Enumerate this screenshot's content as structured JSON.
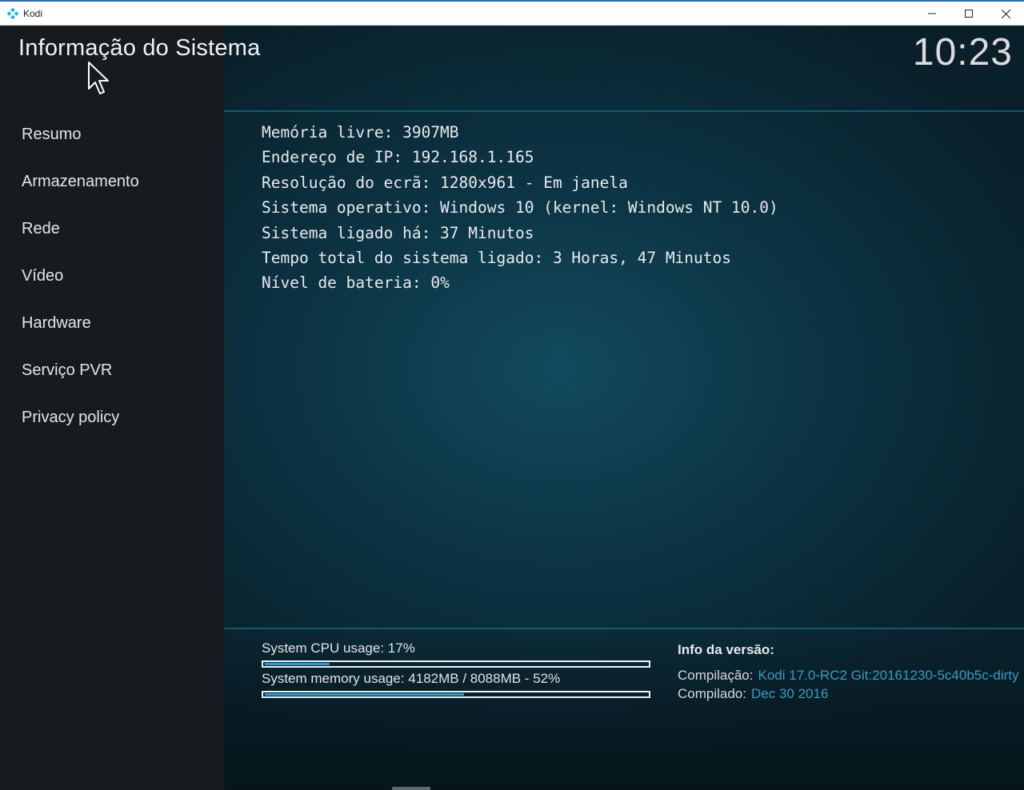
{
  "window": {
    "title": "Kodi",
    "icon": "kodi-logo-icon",
    "controls": [
      "minimize-icon",
      "maximize-icon",
      "close-icon"
    ]
  },
  "header": {
    "title": "Informação do Sistema",
    "clock": "10:23"
  },
  "sidebar": {
    "items": [
      {
        "label": "Resumo"
      },
      {
        "label": "Armazenamento"
      },
      {
        "label": "Rede"
      },
      {
        "label": "Vídeo"
      },
      {
        "label": "Hardware"
      },
      {
        "label": "Serviço PVR"
      },
      {
        "label": "Privacy policy"
      }
    ]
  },
  "summary": {
    "lines": [
      "Memória livre: 3907MB",
      "Endereço de IP: 192.168.1.165",
      "Resolução do ecrã: 1280x961 - Em janela",
      "Sistema operativo: Windows 10 (kernel: Windows NT 10.0)",
      "Sistema ligado há: 37 Minutos",
      "Tempo total do sistema ligado: 3 Horas, 47 Minutos",
      "Nível de bateria: 0%"
    ]
  },
  "usage": {
    "cpu_label": "System CPU usage: 17%",
    "cpu_percent": 17,
    "memory_label": "System memory usage: 4182MB / 8088MB - 52%",
    "memory_percent": 52
  },
  "version": {
    "title": "Info da versão:",
    "build_label": "Compilação:",
    "build_value": "Kodi 17.0-RC2 Git:20161230-5c40b5c-dirty",
    "compiled_label": "Compilado:",
    "compiled_value": "Dec 30 2016"
  },
  "colors": {
    "accent": "#1fa3d6",
    "sidebar_bg": "#161b1f",
    "version_value": "#3d9bc4"
  }
}
